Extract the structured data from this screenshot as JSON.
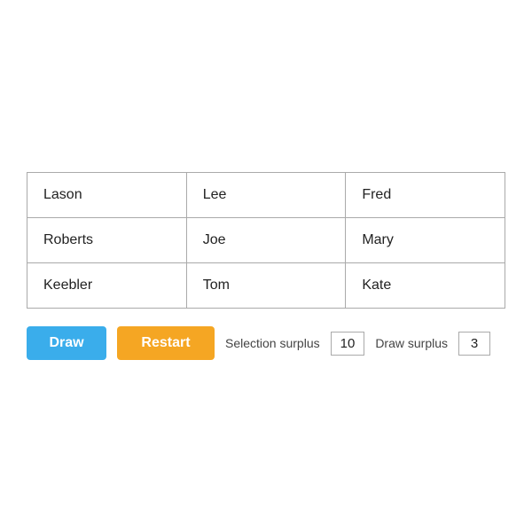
{
  "table": {
    "rows": [
      [
        "Lason",
        "Lee",
        "Fred"
      ],
      [
        "Roberts",
        "Joe",
        "Mary"
      ],
      [
        "Keebler",
        "Tom",
        "Kate"
      ]
    ]
  },
  "controls": {
    "draw_label": "Draw",
    "restart_label": "Restart",
    "selection_surplus_label": "Selection surplus",
    "selection_surplus_value": "10",
    "draw_surplus_label": "Draw surplus",
    "draw_surplus_value": "3"
  }
}
